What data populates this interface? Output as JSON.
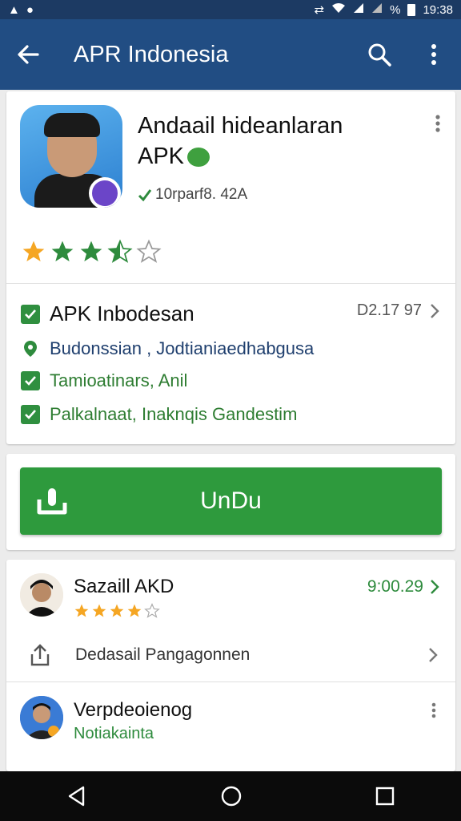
{
  "status_bar": {
    "time": "19:38",
    "battery_text": "%",
    "left_icons": [
      "notification-a-icon",
      "notification-s-icon"
    ],
    "right_icons": [
      "sync-icon",
      "wifi-icon",
      "signal-icon",
      "signal-icon-2",
      "battery-icon"
    ]
  },
  "app_bar": {
    "title": "APR Indonesia",
    "icons": [
      "back-arrow-icon",
      "search-icon",
      "overflow-menu-icon"
    ]
  },
  "app": {
    "name_line1": "Andaail hideanlaran",
    "name_line2": "APK",
    "downloads": "10rparf8. 42A",
    "rating": 3.5,
    "rating_max": 5
  },
  "apk_info": {
    "title": "APK Inbodesan",
    "meta": "D2.17 97",
    "location": "Budonssian , Jodtianiaedhabgusa",
    "feature1": "Tamioatinars, Anil",
    "feature2": "Palkalnaat, Inaknqis Gandestim"
  },
  "download": {
    "label": "UnDu"
  },
  "reviews": [
    {
      "name": "Sazaill AKD",
      "date": "9:00.29",
      "rating": 4,
      "rating_max": 5
    },
    {
      "name": "Verpdeoienog",
      "sub": "Notiakainta"
    }
  ],
  "share_row": {
    "label": "Dedasail Pangagonnen"
  },
  "colors": {
    "status_bar": "#1c3a63",
    "app_bar": "#214d83",
    "accent_green": "#2e9a3d",
    "star_gold": "#f5a623",
    "star_green": "#2e8b3d",
    "location_text": "#1f3f6e"
  }
}
